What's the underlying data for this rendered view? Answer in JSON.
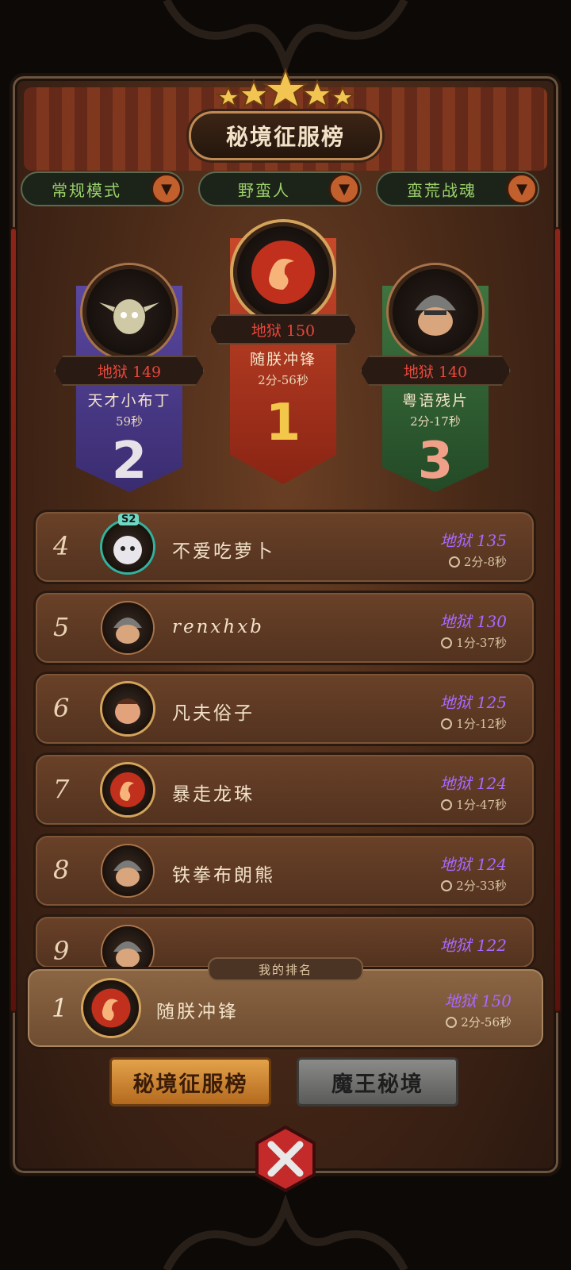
{
  "header": {
    "title": "秘境征服榜"
  },
  "filters": [
    {
      "label": "常规模式"
    },
    {
      "label": "野蛮人"
    },
    {
      "label": "蛮荒战魂"
    }
  ],
  "podium": [
    {
      "rank": "1",
      "score": "地狱 150",
      "name": "随朕冲锋",
      "time": "2分-56秒",
      "color": "#b23a20"
    },
    {
      "rank": "2",
      "score": "地狱 149",
      "name": "天才小布丁",
      "time": "59秒",
      "color": "#4c3c8c"
    },
    {
      "rank": "3",
      "score": "地狱 140",
      "name": "粤语残片",
      "time": "2分-17秒",
      "color": "#2e5c32"
    }
  ],
  "rows": [
    {
      "rank": "4",
      "name": "不爱吃萝卜",
      "score": "地狱 135",
      "time": "2分-8秒",
      "badge": "S2",
      "avatar": "sheep-avatar"
    },
    {
      "rank": "5",
      "name": "renxhxb",
      "score": "地狱 130",
      "time": "1分-37秒",
      "avatar": "helmet-avatar"
    },
    {
      "rank": "6",
      "name": "凡夫俗子",
      "score": "地狱 125",
      "time": "1分-12秒",
      "avatar": "warrior-avatar"
    },
    {
      "rank": "7",
      "name": "暴走龙珠",
      "score": "地狱 124",
      "time": "1分-47秒",
      "avatar": "fire-orb-avatar"
    },
    {
      "rank": "8",
      "name": "铁拳布朗熊",
      "score": "地狱 124",
      "time": "2分-33秒",
      "avatar": "helmet-avatar"
    },
    {
      "rank": "9",
      "name": "",
      "score": "地狱 122",
      "time": "",
      "avatar": "helmet-avatar"
    }
  ],
  "my_rank": {
    "tab_label": "我的排名",
    "rank": "1",
    "name": "随朕冲锋",
    "score": "地狱 150",
    "time": "2分-56秒"
  },
  "bottom_tabs": [
    {
      "label": "秘境征服榜",
      "active": true
    },
    {
      "label": "魔王秘境",
      "active": false
    }
  ],
  "colors": {
    "score_purple": "#a868ff",
    "hell_red": "#e8473a",
    "filter_green": "#9ad06a"
  }
}
